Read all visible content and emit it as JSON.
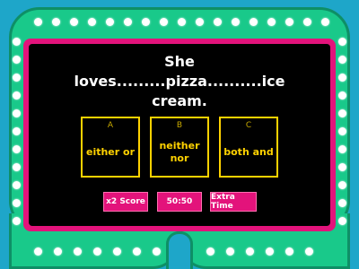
{
  "question": {
    "line1": "She",
    "line2": "loves.........pizza..........ice",
    "line3": "cream."
  },
  "answers": [
    {
      "letter": "A",
      "text": "either or"
    },
    {
      "letter": "B",
      "text": "neither nor"
    },
    {
      "letter": "C",
      "text": "both and"
    }
  ],
  "powerups": {
    "double_score": "x2 Score",
    "fifty_fifty": "50:50",
    "extra_time": "Extra Time"
  },
  "colors": {
    "background": "#1ea6c9",
    "frame": "#19c98a",
    "screen_border": "#e3137b",
    "answer_accent": "#ffd200",
    "text": "#ffffff"
  }
}
